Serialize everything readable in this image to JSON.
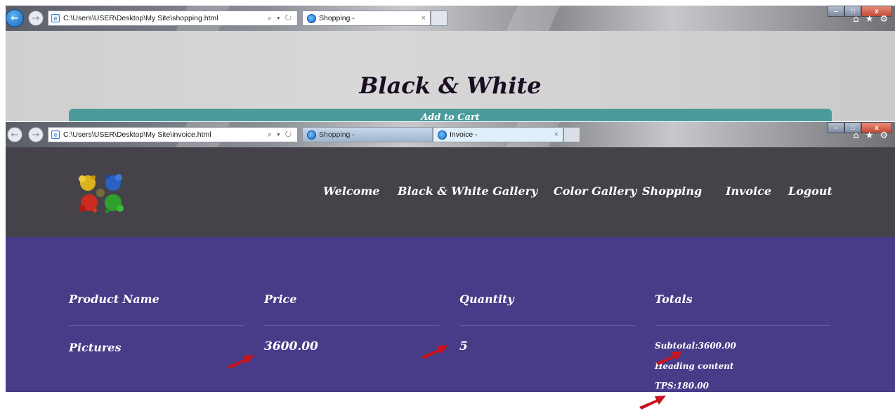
{
  "window1": {
    "address": "C:\\Users\\USER\\Desktop\\My Site\\shopping.html",
    "address_controls": "⌕ ▾ ↻",
    "tab": "Shopping -",
    "tab_close": "×",
    "title": "Black & White",
    "add_to_cart": "Add to Cart"
  },
  "window2": {
    "address": "C:\\Users\\USER\\Desktop\\My Site\\invoice.html",
    "address_controls": "⌕ ▾ ↻",
    "tabs": [
      {
        "label": "Shopping -"
      },
      {
        "label": "Invoice -",
        "close": "×"
      }
    ],
    "nav": [
      "Welcome",
      "Black & White Gallery",
      "Color Gallery",
      "Shopping",
      "Invoice",
      "Logout"
    ],
    "table": {
      "headers": [
        "Product Name",
        "Price",
        "Quantity",
        "Totals"
      ],
      "row": {
        "product": "Pictures",
        "price": "3600.00",
        "quantity": "5"
      },
      "totals": {
        "subtotal": "Subtotal:3600.00",
        "heading": "Heading content",
        "tps": "TPS:180.00"
      }
    }
  },
  "window_controls": {
    "minimize": "–",
    "maximize": "□",
    "close": "x"
  },
  "toolbar_icons": {
    "home": "⌂",
    "favorites": "★",
    "settings": "⚙"
  },
  "colors": {
    "header_bg": "#454249",
    "main_bg": "#473c88",
    "add_to_cart_bg": "#4a9b9b",
    "arrow": "#c8141e"
  }
}
